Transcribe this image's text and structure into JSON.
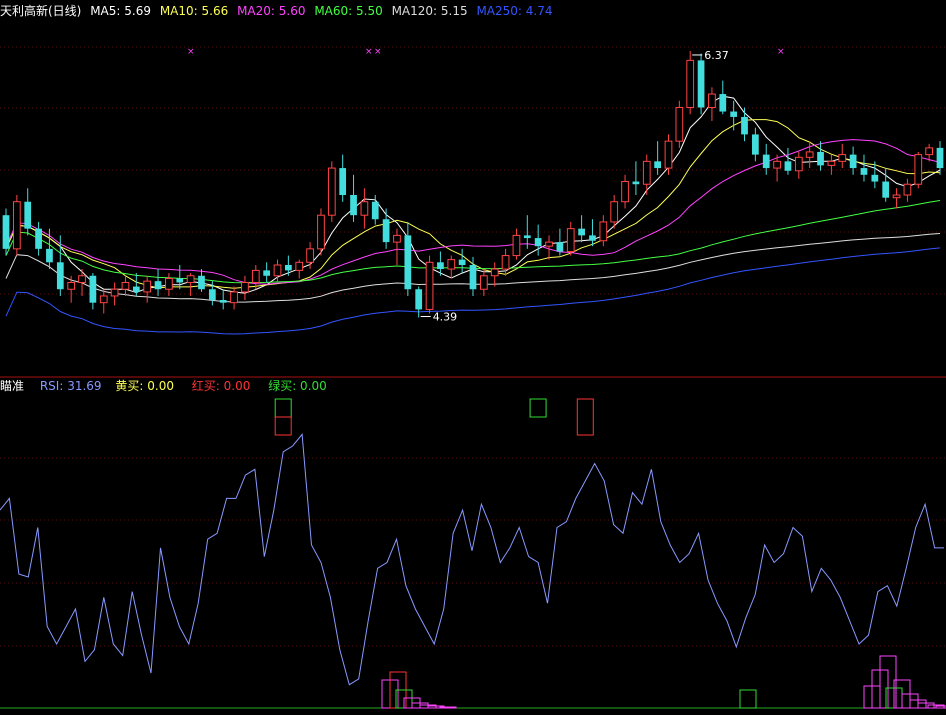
{
  "header": {
    "stock_name": "天利高新(日线)",
    "ma_items": [
      {
        "label": "MA5: 5.69",
        "color": "#ffffff"
      },
      {
        "label": "MA10: 5.66",
        "color": "#ffff55"
      },
      {
        "label": "MA20: 5.60",
        "color": "#ff44ff"
      },
      {
        "label": "MA60: 5.50",
        "color": "#44ff44"
      },
      {
        "label": "MA120: 5.15",
        "color": "#dddddd"
      },
      {
        "label": "MA250: 4.74",
        "color": "#3355ff"
      }
    ]
  },
  "indicator_header": {
    "name": "瞄准",
    "items": [
      {
        "label": "RSI: 31.69",
        "color": "#8899ff"
      },
      {
        "label": "黄买: 0.00",
        "color": "#ffff55"
      },
      {
        "label": "红买: 0.00",
        "color": "#ff3333"
      },
      {
        "label": "绿买: 0.00",
        "color": "#33dd33"
      }
    ]
  },
  "chart_data": [
    {
      "type": "candlestick",
      "title": "天利高新(日线)",
      "ylim": [
        4.0,
        6.6
      ],
      "annotations": [
        {
          "label": "6.37",
          "candle_index": 63,
          "kind": "high"
        },
        {
          "label": "4.39",
          "candle_index": 38,
          "kind": "low"
        }
      ],
      "ohlc": [
        [
          5.15,
          5.2,
          4.85,
          4.9
        ],
        [
          4.9,
          5.3,
          4.85,
          5.25
        ],
        [
          5.25,
          5.35,
          5.0,
          5.05
        ],
        [
          5.05,
          5.1,
          4.85,
          4.9
        ],
        [
          4.9,
          5.05,
          4.75,
          4.8
        ],
        [
          4.8,
          5.0,
          4.55,
          4.6
        ],
        [
          4.6,
          4.7,
          4.5,
          4.65
        ],
        [
          4.65,
          4.75,
          4.55,
          4.7
        ],
        [
          4.7,
          4.72,
          4.45,
          4.5
        ],
        [
          4.5,
          4.6,
          4.42,
          4.55
        ],
        [
          4.55,
          4.65,
          4.48,
          4.6
        ],
        [
          4.6,
          4.7,
          4.55,
          4.65
        ],
        [
          4.62,
          4.72,
          4.55,
          4.58
        ],
        [
          4.58,
          4.7,
          4.5,
          4.66
        ],
        [
          4.66,
          4.75,
          4.55,
          4.6
        ],
        [
          4.6,
          4.72,
          4.55,
          4.68
        ],
        [
          4.68,
          4.78,
          4.6,
          4.65
        ],
        [
          4.65,
          4.72,
          4.55,
          4.7
        ],
        [
          4.7,
          4.75,
          4.58,
          4.6
        ],
        [
          4.6,
          4.66,
          4.48,
          4.52
        ],
        [
          4.52,
          4.6,
          4.45,
          4.5
        ],
        [
          4.5,
          4.62,
          4.45,
          4.58
        ],
        [
          4.58,
          4.7,
          4.52,
          4.65
        ],
        [
          4.65,
          4.78,
          4.6,
          4.74
        ],
        [
          4.74,
          4.8,
          4.65,
          4.7
        ],
        [
          4.7,
          4.82,
          4.66,
          4.78
        ],
        [
          4.78,
          4.85,
          4.7,
          4.74
        ],
        [
          4.74,
          4.82,
          4.68,
          4.8
        ],
        [
          4.8,
          4.95,
          4.75,
          4.9
        ],
        [
          4.9,
          5.2,
          4.85,
          5.15
        ],
        [
          5.15,
          5.55,
          5.1,
          5.5
        ],
        [
          5.5,
          5.6,
          5.25,
          5.3
        ],
        [
          5.3,
          5.45,
          5.1,
          5.15
        ],
        [
          5.15,
          5.35,
          5.05,
          5.25
        ],
        [
          5.25,
          5.3,
          5.08,
          5.12
        ],
        [
          5.12,
          5.2,
          4.9,
          4.95
        ],
        [
          4.95,
          5.05,
          4.78,
          5.0
        ],
        [
          5.0,
          5.1,
          4.55,
          4.6
        ],
        [
          4.6,
          4.62,
          4.39,
          4.45
        ],
        [
          4.45,
          4.85,
          4.42,
          4.8
        ],
        [
          4.8,
          4.88,
          4.7,
          4.75
        ],
        [
          4.75,
          4.85,
          4.68,
          4.82
        ],
        [
          4.82,
          4.9,
          4.72,
          4.78
        ],
        [
          4.78,
          4.84,
          4.55,
          4.6
        ],
        [
          4.6,
          4.75,
          4.55,
          4.7
        ],
        [
          4.7,
          4.8,
          4.62,
          4.75
        ],
        [
          4.75,
          4.9,
          4.7,
          4.85
        ],
        [
          4.85,
          5.05,
          4.82,
          5.0
        ],
        [
          5.0,
          5.15,
          4.9,
          4.98
        ],
        [
          4.98,
          5.08,
          4.85,
          4.92
        ],
        [
          4.92,
          5.0,
          4.82,
          4.95
        ],
        [
          4.95,
          5.05,
          4.85,
          4.88
        ],
        [
          4.88,
          5.1,
          4.85,
          5.05
        ],
        [
          5.05,
          5.15,
          4.95,
          5.0
        ],
        [
          5.0,
          5.12,
          4.92,
          4.96
        ],
        [
          4.96,
          5.15,
          4.92,
          5.1
        ],
        [
          5.1,
          5.3,
          5.05,
          5.25
        ],
        [
          5.25,
          5.45,
          5.2,
          5.4
        ],
        [
          5.4,
          5.55,
          5.3,
          5.38
        ],
        [
          5.38,
          5.6,
          5.3,
          5.55
        ],
        [
          5.55,
          5.7,
          5.45,
          5.5
        ],
        [
          5.5,
          5.75,
          5.45,
          5.7
        ],
        [
          5.7,
          6.0,
          5.65,
          5.95
        ],
        [
          5.95,
          6.37,
          5.9,
          6.3
        ],
        [
          6.3,
          6.35,
          5.9,
          5.95
        ],
        [
          5.95,
          6.1,
          5.85,
          6.05
        ],
        [
          6.05,
          6.15,
          5.9,
          5.92
        ],
        [
          5.92,
          6.0,
          5.78,
          5.88
        ],
        [
          5.88,
          5.95,
          5.7,
          5.75
        ],
        [
          5.75,
          5.8,
          5.55,
          5.6
        ],
        [
          5.6,
          5.68,
          5.45,
          5.5
        ],
        [
          5.5,
          5.6,
          5.4,
          5.55
        ],
        [
          5.55,
          5.65,
          5.45,
          5.48
        ],
        [
          5.48,
          5.62,
          5.42,
          5.58
        ],
        [
          5.58,
          5.7,
          5.5,
          5.62
        ],
        [
          5.62,
          5.7,
          5.48,
          5.52
        ],
        [
          5.52,
          5.6,
          5.45,
          5.55
        ],
        [
          5.55,
          5.68,
          5.5,
          5.6
        ],
        [
          5.6,
          5.66,
          5.45,
          5.5
        ],
        [
          5.5,
          5.6,
          5.4,
          5.45
        ],
        [
          5.45,
          5.55,
          5.35,
          5.4
        ],
        [
          5.4,
          5.5,
          5.25,
          5.28
        ],
        [
          5.28,
          5.35,
          5.2,
          5.3
        ],
        [
          5.3,
          5.42,
          5.25,
          5.38
        ],
        [
          5.38,
          5.62,
          5.35,
          5.6
        ],
        [
          5.6,
          5.68,
          5.55,
          5.65
        ],
        [
          5.65,
          5.7,
          5.45,
          5.5
        ]
      ],
      "ma_series": [
        {
          "name": "MA5",
          "color": "#ffffff"
        },
        {
          "name": "MA10",
          "color": "#ffff55"
        },
        {
          "name": "MA20",
          "color": "#ff44ff"
        },
        {
          "name": "MA60",
          "color": "#44ff44"
        },
        {
          "name": "MA120",
          "color": "#dddddd"
        },
        {
          "name": "MA250",
          "color": "#3355ff"
        }
      ]
    },
    {
      "type": "line",
      "title": "瞄准",
      "ylim": [
        0,
        100
      ],
      "series": [
        {
          "name": "RSI",
          "color": "#8899ff",
          "values": [
            68,
            72,
            46,
            45,
            62,
            28,
            22,
            28,
            34,
            16,
            20,
            38,
            22,
            18,
            40,
            25,
            12,
            55,
            38,
            28,
            22,
            36,
            58,
            60,
            72,
            72,
            80,
            82,
            52,
            68,
            88,
            90,
            94,
            56,
            50,
            38,
            20,
            8,
            10,
            30,
            48,
            50,
            58,
            42,
            34,
            28,
            22,
            34,
            60,
            68,
            54,
            70,
            62,
            50,
            55,
            62,
            52,
            50,
            36,
            62,
            64,
            72,
            78,
            84,
            78,
            63,
            60,
            74,
            70,
            82,
            64,
            56,
            50,
            53,
            60,
            44,
            36,
            30,
            21,
            31,
            39,
            56,
            50,
            53,
            62,
            59,
            40,
            48,
            44,
            38,
            30,
            22,
            25,
            40,
            42,
            35,
            48,
            62,
            70,
            55,
            55
          ]
        }
      ],
      "markers": [
        {
          "kind": "signal",
          "index": 30,
          "color": "#33dd33"
        },
        {
          "kind": "signal",
          "index": 57,
          "color": "#33dd33"
        },
        {
          "kind": "signal",
          "index": 62,
          "color": "#ff3333"
        }
      ]
    }
  ]
}
